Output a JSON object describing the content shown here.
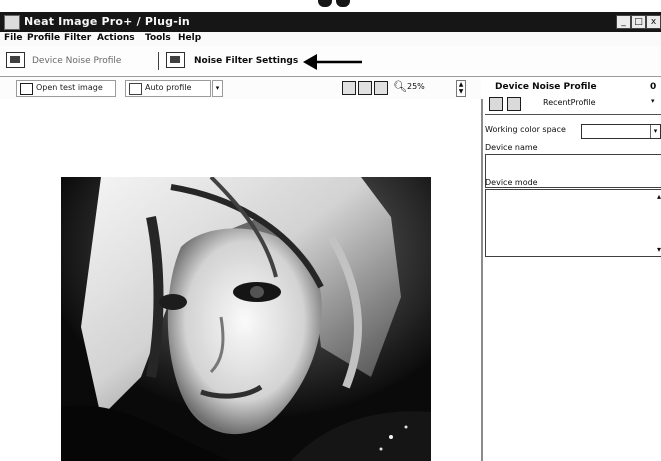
{
  "window": {
    "title": "Neat Image Pro+ / Plug-in",
    "controls": {
      "minimize": "_",
      "maximize": "□",
      "close": "x"
    }
  },
  "menu": [
    "File",
    "Profile",
    "Filter",
    "Actions",
    "Tools",
    "Help"
  ],
  "modes": {
    "device_noise_profile": "Device Noise Profile",
    "noise_filter_settings": "Noise Filter Settings",
    "active": "noise_filter_settings"
  },
  "toolbar": {
    "open_test_image": "Open test image",
    "auto_profile": "Auto profile",
    "zoom_value": "25%",
    "zoom_icon": "magnifier-icon"
  },
  "right_panel": {
    "title": "Device Noise Profile",
    "close": "0",
    "profile_name": "RecentProfile",
    "working_color_space_label": "Working color space",
    "working_color_space_value": "",
    "device_name_label": "Device name",
    "device_name_value": "",
    "device_mode_label": "Device mode",
    "device_mode_value": ""
  },
  "colors": {
    "title_bar": "#1b1b1b",
    "window_bg": "#f6f6f6",
    "canvas_bg": "#ffffff"
  }
}
